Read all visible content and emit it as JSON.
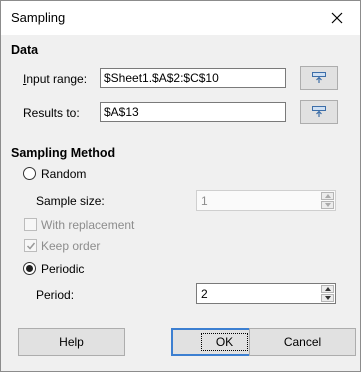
{
  "window": {
    "title": "Sampling"
  },
  "data_section": {
    "title": "Data",
    "input_range_label": "Input range:",
    "input_range_value": "$Sheet1.$A$2:$C$10",
    "results_to_label": "Results to:",
    "results_to_value": "$A$13"
  },
  "sampling_method": {
    "title": "Sampling Method",
    "random_label": "Random",
    "random_selected": false,
    "sample_size_label": "Sample size:",
    "sample_size_value": "1",
    "with_replacement_label": "With replacement",
    "with_replacement_checked": false,
    "keep_order_label": "Keep order",
    "keep_order_checked": true,
    "periodic_label": "Periodic",
    "periodic_selected": true,
    "period_label": "Period:",
    "period_value": "2"
  },
  "buttons": {
    "help": "Help",
    "ok": "OK",
    "cancel": "Cancel"
  }
}
